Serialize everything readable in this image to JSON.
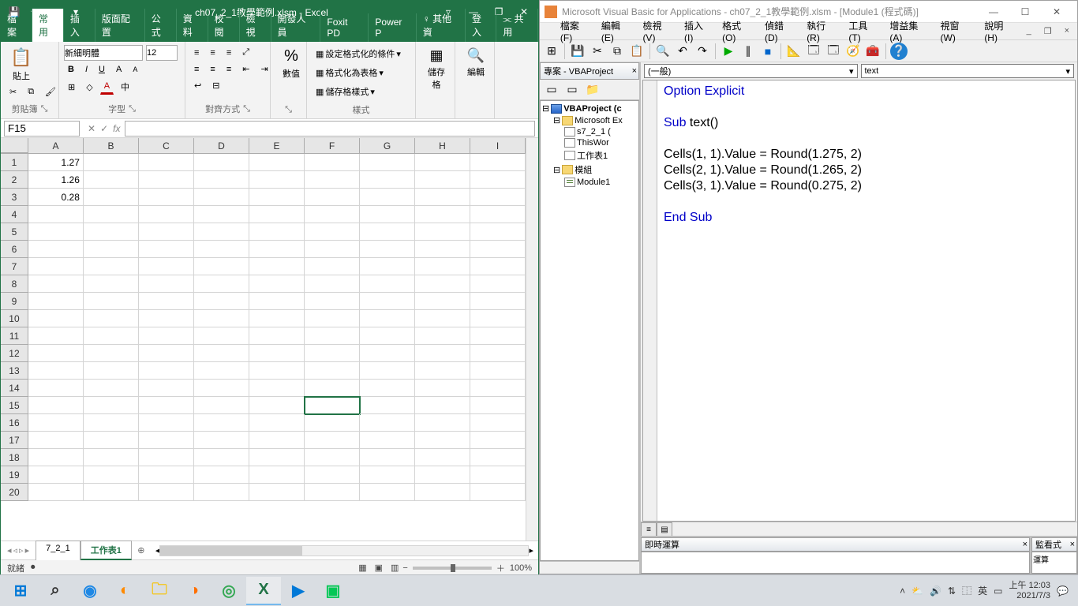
{
  "excel": {
    "title": "ch07_2_1教學範例.xlsm - Excel",
    "qat": {
      "save": "💾",
      "undo": "↶",
      "redo": "↷"
    },
    "win": {
      "opts": "▿",
      "help": "❔",
      "min": "—",
      "max": "❐",
      "close": "✕"
    },
    "tabs": [
      "檔案",
      "常用",
      "插入",
      "版面配置",
      "公式",
      "資料",
      "校閱",
      "檢視",
      "開發人員",
      "Foxit PD",
      "Power P"
    ],
    "tabs_active_index": 1,
    "right_tabs": {
      "tellme": "其他資",
      "tellme_icon": "♀",
      "signin": "登入",
      "share": "共用",
      "share_icon": "⫘"
    },
    "ribbon": {
      "clipboard": {
        "paste": "貼上",
        "label": "剪貼簿"
      },
      "font": {
        "name": "新細明體",
        "size": "12",
        "label": "字型",
        "bold": "B",
        "italic": "I",
        "underline": "U",
        "grow": "A",
        "shrink": "A",
        "border": "⊞",
        "fill": "◇",
        "color": "A",
        "phonetic": "中"
      },
      "align": {
        "label": "對齊方式",
        "top": "⬆",
        "mid": "↔",
        "bot": "⬇",
        "indent_dec": "⇤",
        "indent_inc": "⇥",
        "left": "≡",
        "center": "≡",
        "right": "≡",
        "wrap": "↩",
        "merge": "⊟"
      },
      "number": {
        "label": "數值",
        "percent": "%"
      },
      "styles": {
        "cond": "設定格式化的條件",
        "table": "格式化為表格",
        "cell": "儲存格樣式",
        "label": "樣式"
      },
      "cells": {
        "btn": "儲存格",
        "label": "儲存格"
      },
      "editing": {
        "btn": "編輯",
        "label": "編輯"
      }
    },
    "namebox": "F15",
    "fx": {
      "cancel": "✕",
      "enter": "✓",
      "fx": "fx"
    },
    "columns": [
      "A",
      "B",
      "C",
      "D",
      "E",
      "F",
      "G",
      "H",
      "I"
    ],
    "row_count": 20,
    "cells": {
      "A1": "1.27",
      "A2": "1.26",
      "A3": "0.28"
    },
    "selected": "F15",
    "sheets": {
      "nav": [
        "◂",
        "◃",
        "▹",
        "▸"
      ],
      "list": [
        "7_2_1",
        "工作表1"
      ],
      "active_index": 1,
      "add": "⊕"
    },
    "status": {
      "ready": "就緒",
      "macro": "⏺",
      "views": [
        "▦",
        "▣",
        "▥"
      ],
      "zoom_out": "−",
      "zoom_in": "＋",
      "zoom": "100%"
    }
  },
  "vba": {
    "title": "Microsoft Visual Basic for Applications - ch07_2_1教學範例.xlsm - [Module1 (程式碼)]",
    "win": {
      "min": "—",
      "max": "☐",
      "close": "✕"
    },
    "menu": [
      "檔案(F)",
      "編輯(E)",
      "檢視(V)",
      "插入(I)",
      "格式(O)",
      "偵錯(D)",
      "執行(R)",
      "工具(T)",
      "增益集(A)",
      "視窗(W)",
      "說明(H)"
    ],
    "mdi": {
      "min": "_",
      "restore": "❐",
      "close": "×"
    },
    "toolbar_icons": [
      "excel-icon",
      "save-icon",
      "cut-icon",
      "copy-icon",
      "paste-icon",
      "find-icon",
      "undo-icon",
      "redo-icon",
      "run-icon",
      "break-icon",
      "reset-icon",
      "design-icon",
      "project-icon",
      "properties-icon",
      "browser-icon",
      "toolbox-icon",
      "help-icon"
    ],
    "toolbar_glyphs": [
      "⊞",
      "💾",
      "✂",
      "⧉",
      "📋",
      "🔍",
      "↶",
      "↷",
      "▶",
      "∥",
      "■",
      "📐",
      "🗔",
      "🗔",
      "🧭",
      "🧰",
      "❔"
    ],
    "project": {
      "title": "專案 - VBAProject",
      "tb": [
        "▭",
        "▭",
        "📁"
      ],
      "root": "VBAProject (c",
      "ms_excel": "Microsoft Ex",
      "sheet1": "s7_2_1 (",
      "thiswb": "ThisWor",
      "sheet2": "工作表1",
      "modules": "模組",
      "module1": "Module1"
    },
    "code": {
      "dd_left": "(一般)",
      "dd_right": "text",
      "lines": [
        {
          "t": "Option Explicit",
          "kw": true
        },
        {
          "t": "",
          "kw": false
        },
        {
          "t": "Sub text()",
          "kw": true,
          "plain": " text()",
          "lead": "Sub"
        },
        {
          "t": "",
          "kw": false
        },
        {
          "t": "Cells(1, 1).Value = Round(1.275, 2)",
          "kw": false
        },
        {
          "t": "Cells(2, 1).Value = Round(1.265, 2)",
          "kw": false
        },
        {
          "t": "Cells(3, 1).Value = Round(0.275, 2)",
          "kw": false
        },
        {
          "t": "",
          "kw": false
        },
        {
          "t": "End Sub",
          "kw": true
        }
      ]
    },
    "immediate": {
      "title": "即時運算"
    },
    "watch": {
      "title": "監看式",
      "expr": "運算"
    }
  },
  "taskbar": {
    "items": [
      {
        "name": "start-button",
        "glyph": "⊞",
        "color": "#0078d7"
      },
      {
        "name": "search-button",
        "glyph": "⌕",
        "color": "#333"
      },
      {
        "name": "edge-icon",
        "glyph": "◉",
        "color": "#1e88e5"
      },
      {
        "name": "firefox-dev-icon",
        "glyph": "◐",
        "color": "#ff8a00"
      },
      {
        "name": "explorer-icon",
        "glyph": "🗀",
        "color": "#f5c518"
      },
      {
        "name": "firefox-icon",
        "glyph": "◑",
        "color": "#ff6f00"
      },
      {
        "name": "chrome-icon",
        "glyph": "◎",
        "color": "#34a853"
      },
      {
        "name": "excel-app-icon",
        "glyph": "X",
        "color": "#217346",
        "active": true
      },
      {
        "name": "movies-icon",
        "glyph": "▶",
        "color": "#0078d7"
      },
      {
        "name": "line-icon",
        "glyph": "▣",
        "color": "#03c755"
      }
    ],
    "tray": {
      "chevron": "˄",
      "onedrive": "⛅",
      "volume": "🔊",
      "net": "⇅",
      "wifi": "⿰",
      "ime": "英",
      "action": "▭"
    },
    "clock": {
      "time": "上午 12:03",
      "date": "2021/7/3"
    },
    "notif": "💬"
  }
}
